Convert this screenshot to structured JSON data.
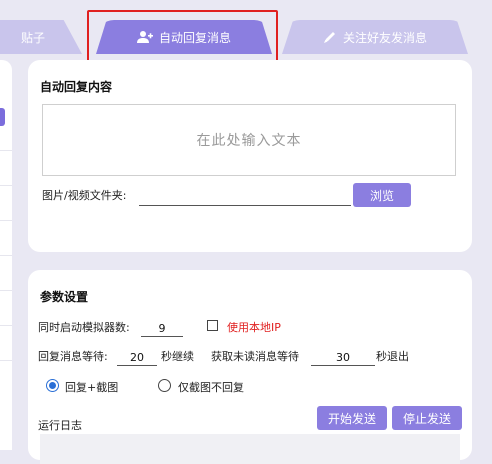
{
  "tabs": {
    "left_label": "贴子",
    "active_label": "自动回复消息",
    "right_label": "关注好友发消息"
  },
  "reply_content": {
    "title": "自动回复内容",
    "text_placeholder": "在此处输入文本",
    "media_label": "图片/视频文件夹:",
    "media_value": "",
    "browse_label": "浏览"
  },
  "params": {
    "title": "参数设置",
    "emulators_label": "同时启动模拟器数:",
    "emulators_value": "9",
    "use_local_ip_label": "使用本地IP",
    "use_local_ip_checked": false,
    "reply_wait_label": "回复消息等待:",
    "reply_wait_value": "20",
    "reply_wait_suffix": "秒继续",
    "fetch_wait_label": "获取未读消息等待",
    "fetch_wait_value": "30",
    "fetch_wait_suffix": "秒退出",
    "mode_options": [
      "回复+截图",
      "仅截图不回复"
    ],
    "mode_selected": "回复+截图",
    "log_label": "运行日志",
    "start_label": "开始发送",
    "stop_label": "停止发送"
  },
  "colors": {
    "accent": "#8b7ee0",
    "tab_inactive": "#c9c5ec",
    "background": "#e9e8f3",
    "warning_text": "#e02020",
    "radio_blue": "#2a6fd6"
  }
}
